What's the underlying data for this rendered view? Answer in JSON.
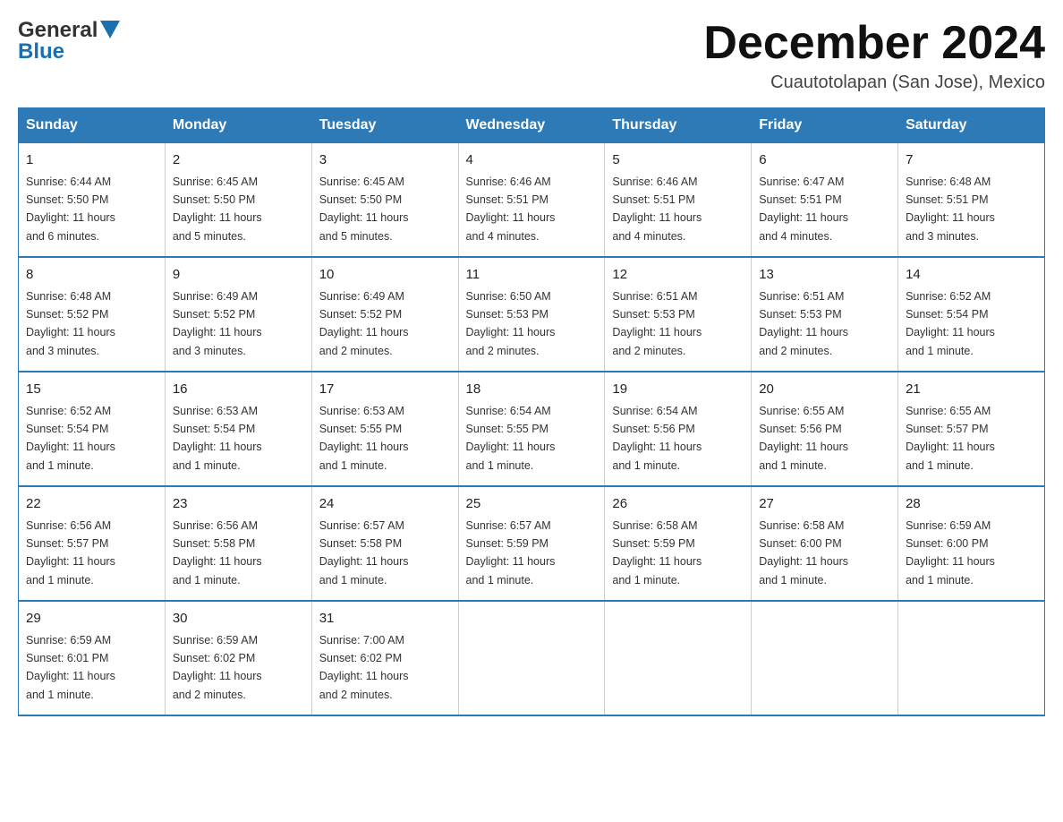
{
  "logo": {
    "general": "General",
    "blue": "Blue",
    "triangle_alt": "▲"
  },
  "header": {
    "month_year": "December 2024",
    "location": "Cuautotolapan (San Jose), Mexico"
  },
  "days_of_week": [
    "Sunday",
    "Monday",
    "Tuesday",
    "Wednesday",
    "Thursday",
    "Friday",
    "Saturday"
  ],
  "weeks": [
    [
      {
        "day": "1",
        "sunrise": "6:44 AM",
        "sunset": "5:50 PM",
        "daylight": "11 hours and 6 minutes."
      },
      {
        "day": "2",
        "sunrise": "6:45 AM",
        "sunset": "5:50 PM",
        "daylight": "11 hours and 5 minutes."
      },
      {
        "day": "3",
        "sunrise": "6:45 AM",
        "sunset": "5:50 PM",
        "daylight": "11 hours and 5 minutes."
      },
      {
        "day": "4",
        "sunrise": "6:46 AM",
        "sunset": "5:51 PM",
        "daylight": "11 hours and 4 minutes."
      },
      {
        "day": "5",
        "sunrise": "6:46 AM",
        "sunset": "5:51 PM",
        "daylight": "11 hours and 4 minutes."
      },
      {
        "day": "6",
        "sunrise": "6:47 AM",
        "sunset": "5:51 PM",
        "daylight": "11 hours and 4 minutes."
      },
      {
        "day": "7",
        "sunrise": "6:48 AM",
        "sunset": "5:51 PM",
        "daylight": "11 hours and 3 minutes."
      }
    ],
    [
      {
        "day": "8",
        "sunrise": "6:48 AM",
        "sunset": "5:52 PM",
        "daylight": "11 hours and 3 minutes."
      },
      {
        "day": "9",
        "sunrise": "6:49 AM",
        "sunset": "5:52 PM",
        "daylight": "11 hours and 3 minutes."
      },
      {
        "day": "10",
        "sunrise": "6:49 AM",
        "sunset": "5:52 PM",
        "daylight": "11 hours and 2 minutes."
      },
      {
        "day": "11",
        "sunrise": "6:50 AM",
        "sunset": "5:53 PM",
        "daylight": "11 hours and 2 minutes."
      },
      {
        "day": "12",
        "sunrise": "6:51 AM",
        "sunset": "5:53 PM",
        "daylight": "11 hours and 2 minutes."
      },
      {
        "day": "13",
        "sunrise": "6:51 AM",
        "sunset": "5:53 PM",
        "daylight": "11 hours and 2 minutes."
      },
      {
        "day": "14",
        "sunrise": "6:52 AM",
        "sunset": "5:54 PM",
        "daylight": "11 hours and 1 minute."
      }
    ],
    [
      {
        "day": "15",
        "sunrise": "6:52 AM",
        "sunset": "5:54 PM",
        "daylight": "11 hours and 1 minute."
      },
      {
        "day": "16",
        "sunrise": "6:53 AM",
        "sunset": "5:54 PM",
        "daylight": "11 hours and 1 minute."
      },
      {
        "day": "17",
        "sunrise": "6:53 AM",
        "sunset": "5:55 PM",
        "daylight": "11 hours and 1 minute."
      },
      {
        "day": "18",
        "sunrise": "6:54 AM",
        "sunset": "5:55 PM",
        "daylight": "11 hours and 1 minute."
      },
      {
        "day": "19",
        "sunrise": "6:54 AM",
        "sunset": "5:56 PM",
        "daylight": "11 hours and 1 minute."
      },
      {
        "day": "20",
        "sunrise": "6:55 AM",
        "sunset": "5:56 PM",
        "daylight": "11 hours and 1 minute."
      },
      {
        "day": "21",
        "sunrise": "6:55 AM",
        "sunset": "5:57 PM",
        "daylight": "11 hours and 1 minute."
      }
    ],
    [
      {
        "day": "22",
        "sunrise": "6:56 AM",
        "sunset": "5:57 PM",
        "daylight": "11 hours and 1 minute."
      },
      {
        "day": "23",
        "sunrise": "6:56 AM",
        "sunset": "5:58 PM",
        "daylight": "11 hours and 1 minute."
      },
      {
        "day": "24",
        "sunrise": "6:57 AM",
        "sunset": "5:58 PM",
        "daylight": "11 hours and 1 minute."
      },
      {
        "day": "25",
        "sunrise": "6:57 AM",
        "sunset": "5:59 PM",
        "daylight": "11 hours and 1 minute."
      },
      {
        "day": "26",
        "sunrise": "6:58 AM",
        "sunset": "5:59 PM",
        "daylight": "11 hours and 1 minute."
      },
      {
        "day": "27",
        "sunrise": "6:58 AM",
        "sunset": "6:00 PM",
        "daylight": "11 hours and 1 minute."
      },
      {
        "day": "28",
        "sunrise": "6:59 AM",
        "sunset": "6:00 PM",
        "daylight": "11 hours and 1 minute."
      }
    ],
    [
      {
        "day": "29",
        "sunrise": "6:59 AM",
        "sunset": "6:01 PM",
        "daylight": "11 hours and 1 minute."
      },
      {
        "day": "30",
        "sunrise": "6:59 AM",
        "sunset": "6:02 PM",
        "daylight": "11 hours and 2 minutes."
      },
      {
        "day": "31",
        "sunrise": "7:00 AM",
        "sunset": "6:02 PM",
        "daylight": "11 hours and 2 minutes."
      },
      null,
      null,
      null,
      null
    ]
  ],
  "labels": {
    "sunrise": "Sunrise:",
    "sunset": "Sunset:",
    "daylight": "Daylight:"
  }
}
